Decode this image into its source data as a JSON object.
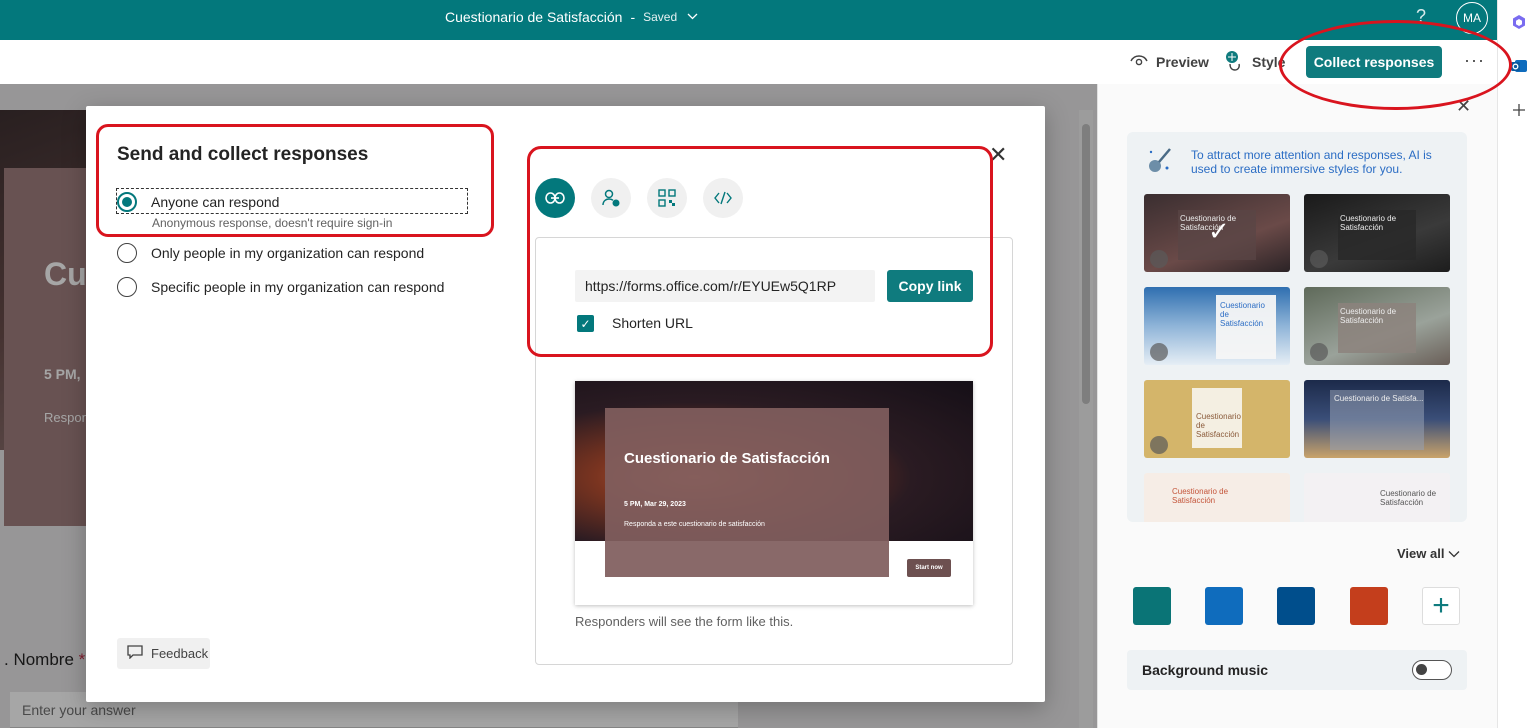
{
  "topbar": {
    "title": "Cuestionario de Satisfacción",
    "separator": "-",
    "saved": "Saved",
    "help": "?",
    "avatar": "MA"
  },
  "cmdbar": {
    "preview_label": "Preview",
    "style_label": "Style",
    "collect_label": "Collect responses",
    "more_label": "···"
  },
  "background_form": {
    "title_fragment": "Cue",
    "time_fragment": "5 PM,",
    "respond_fragment": "Respon",
    "question_label": ". Nombre",
    "required_mark": "*",
    "answer_placeholder": "Enter your answer"
  },
  "modal": {
    "title": "Send and collect responses",
    "options": [
      {
        "label": "Anyone can respond",
        "sub": "Anonymous response, doesn't require sign-in",
        "selected": true
      },
      {
        "label": "Only people in my organization can respond",
        "selected": false
      },
      {
        "label": "Specific people in my organization can respond",
        "selected": false
      }
    ],
    "close": "✕",
    "share_tabs": [
      {
        "name": "link-icon",
        "active": true
      },
      {
        "name": "invite-person-icon",
        "active": false
      },
      {
        "name": "qr-code-icon",
        "active": false
      },
      {
        "name": "embed-code-icon",
        "active": false
      }
    ],
    "url": "https://forms.office.com/r/EYUEw5Q1RP",
    "copy_label": "Copy link",
    "shorten_label": "Shorten URL",
    "shorten_checked": true,
    "preview": {
      "title": "Cuestionario de Satisfacción",
      "date": "5 PM, Mar 29, 2023",
      "desc": "Responda a este cuestionario de satisfacción",
      "start": "Start now"
    },
    "preview_note": "Responders will see the form like this.",
    "feedback_label": "Feedback"
  },
  "side_panel": {
    "close": "✕",
    "ai_text": "To attract more attention and responses, AI is used to create immersive styles for you.",
    "theme_thumbs": [
      {
        "title": "Cuestionario de Satisfacción"
      },
      {
        "title": "Cuestionario de Satisfacción"
      },
      {
        "title": "Cuestionario de Satisfacción"
      },
      {
        "title": "Cuestionario de Satisfacción"
      },
      {
        "title": "Cuestionario de Satisfacción"
      },
      {
        "title": "Cuestionario de Satisfa..."
      },
      {
        "title": "Cuestionario de Satisfacción"
      },
      {
        "title": "Cuestionario de Satisfacción"
      }
    ],
    "view_all": "View all",
    "swatches": [
      "#0a7476",
      "#0f6cbd",
      "#004e8c",
      "#c43e1c"
    ],
    "add_color": "+",
    "music_label": "Background music",
    "music_on": false
  },
  "colors": {
    "brand": "#03787c",
    "button": "#0f7b7e",
    "annotation": "#d9141e"
  }
}
